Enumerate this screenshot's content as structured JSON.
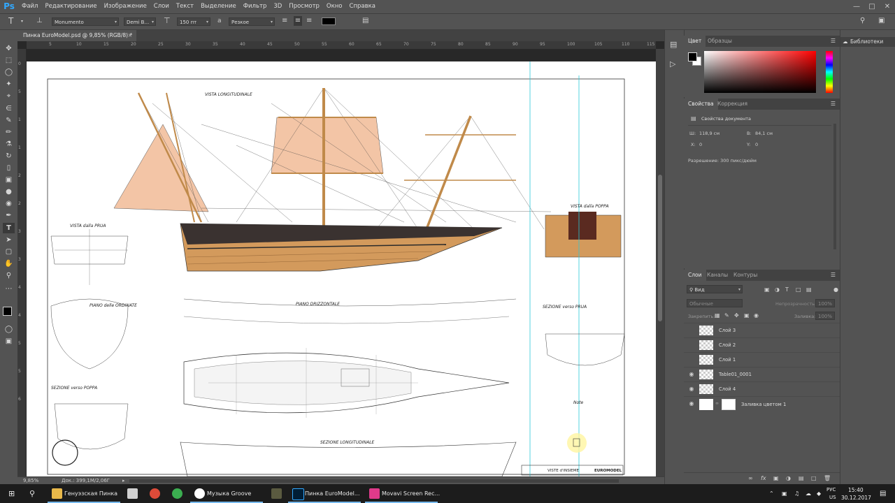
{
  "app": {
    "logo": "Ps",
    "menu": [
      "Файл",
      "Редактирование",
      "Изображение",
      "Слои",
      "Текст",
      "Выделение",
      "Фильтр",
      "3D",
      "Просмотр",
      "Окно",
      "Справка"
    ]
  },
  "options": {
    "font_family": "Monumento",
    "font_style": "Demi B...",
    "font_size": "150 пт",
    "antialias": "Резкое",
    "text_color": "#000000"
  },
  "document": {
    "tab_title": "Пинка EuroModel.psd @ 9,85% (RGB/8) *",
    "ruler_top": [
      "5",
      "10",
      "15",
      "20",
      "25",
      "30",
      "35",
      "40",
      "45",
      "50",
      "55",
      "60",
      "65",
      "70",
      "75",
      "80",
      "85",
      "90",
      "95",
      "100",
      "105",
      "110",
      "115"
    ],
    "ruler_left": [
      "0",
      "5",
      "1",
      "1",
      "2",
      "2",
      "3",
      "3",
      "4",
      "4",
      "5",
      "5",
      "6"
    ],
    "drawing_texts": [
      "VISTA LONGITUDINALE",
      "VISTA dalla PRUA",
      "VISTA dalla POPPA",
      "PIANO DRIZZONTALE",
      "PIANO delle ORDINATE",
      "SEZIONE verso POPPA",
      "SEZIONE verso PRUA",
      "SEZIONE LONGITUDINALE",
      "Note",
      "VISTE d'INSIEME",
      "EUROMODEL"
    ]
  },
  "status": {
    "zoom": "9,85%",
    "doc": "Док.: 399,1М/2,06Г"
  },
  "panels": {
    "color_tabs": [
      "Цвет",
      "Образцы"
    ],
    "props_tabs": [
      "Свойства",
      "Коррекция"
    ],
    "props_title": "Свойства документа",
    "width_label": "Ш:",
    "width_value": "118,9 см",
    "height_label": "В:",
    "height_value": "84,1 см",
    "x_label": "X:",
    "x_value": "0",
    "y_label": "Y:",
    "y_value": "0",
    "resolution": "Разрешение: 300 пикс/дюйм",
    "layers_tabs": [
      "Слои",
      "Каналы",
      "Контуры"
    ],
    "filter_kind": "Вид",
    "blend_mode": "Обычные",
    "opacity_label": "Непрозрачность:",
    "opacity_value": "100%",
    "lock_label": "Закрепить:",
    "fill_label": "Заливка:",
    "fill_value": "100%",
    "layers": [
      {
        "name": "Слой 3",
        "visible": false
      },
      {
        "name": "Слой 2",
        "visible": false
      },
      {
        "name": "Слой 1",
        "visible": false
      },
      {
        "name": "Table01_0001",
        "visible": true
      },
      {
        "name": "Слой 4",
        "visible": true
      },
      {
        "name": "Заливка цветом 1",
        "visible": true
      }
    ],
    "libraries": "Библиотеки"
  },
  "taskbar": {
    "items": [
      "Генуэзская Пинка",
      "Музыка Groove",
      "Пинка EuroModel...",
      "Movavi Screen Rec..."
    ],
    "lang": "РУС",
    "lang2": "US",
    "time": "15:40",
    "date": "30.12.2017"
  }
}
